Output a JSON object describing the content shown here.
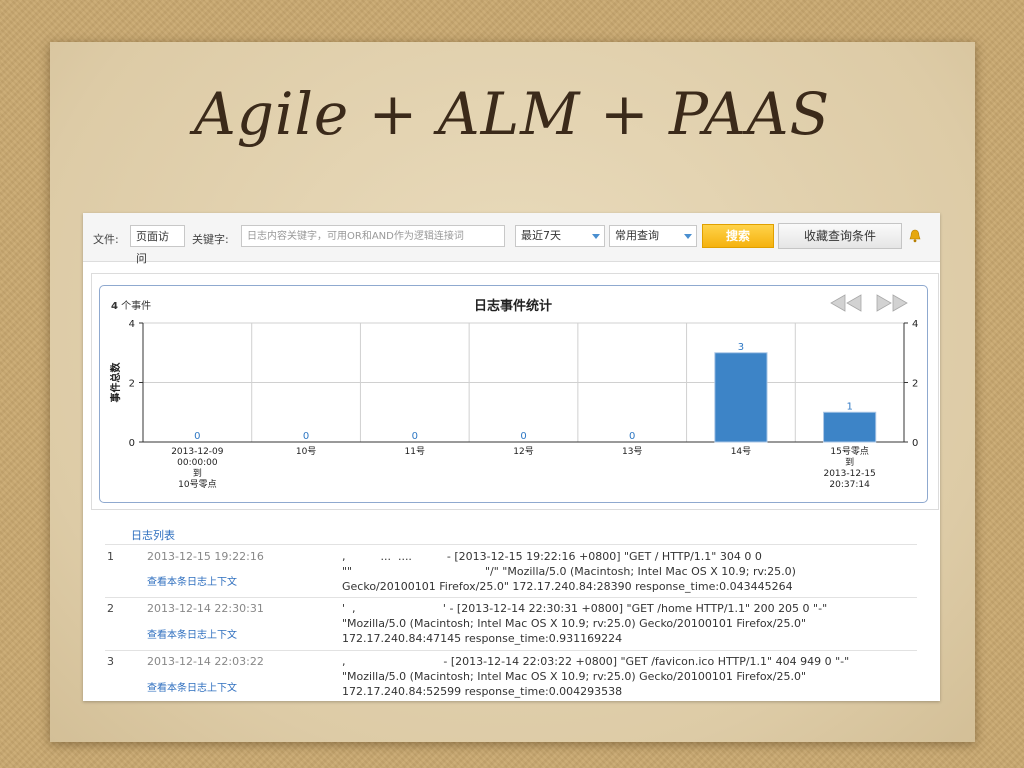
{
  "slide": {
    "title": "Agile + ALM + PAAS"
  },
  "toolbar": {
    "file_label": "文件:",
    "file_value": "页面访问",
    "keyword_label": "关键字:",
    "keyword_placeholder": "日志内容关键字，可用OR和AND作为逻辑连接词",
    "range_value": "最近7天",
    "query_value": "常用查询",
    "search_label": "搜索",
    "save_label": "收藏查询条件"
  },
  "chart": {
    "count_num": "4",
    "count_label": "个事件",
    "title": "日志事件统计",
    "ylabel": "事件总数"
  },
  "chart_data": {
    "type": "bar",
    "title": "日志事件统计",
    "ylabel": "事件总数",
    "xlabel": "",
    "ylim": [
      0,
      4
    ],
    "y_ticks": [
      "0",
      "2",
      "4"
    ],
    "categories": [
      "2013-12-09\n00:00:00\n到\n10号零点",
      "10号",
      "11号",
      "12号",
      "13号",
      "14号",
      "15号零点\n到\n2013-12-15\n20:37:14"
    ],
    "values": [
      0,
      0,
      0,
      0,
      0,
      3,
      1
    ],
    "data_labels": [
      "0",
      "0",
      "0",
      "0",
      "0",
      "3",
      "1"
    ],
    "bar_color": "#3d84c7",
    "grid": true
  },
  "log": {
    "header": "日志列表",
    "rows": [
      {
        "num": "1",
        "time": "2013-12-15 19:22:16",
        "link": "查看本条日志上下文",
        "message": ",          ...  ....          - [2013-12-15 19:22:16 +0800] \"GET / HTTP/1.1\" 304 0 0\n\"\"                                      \"/\" \"Mozilla/5.0 (Macintosh; Intel Mac OS X 10.9; rv:25.0)\nGecko/20100101 Firefox/25.0\" 172.17.240.84:28390 response_time:0.043445264"
      },
      {
        "num": "2",
        "time": "2013-12-14 22:30:31",
        "link": "查看本条日志上下文",
        "message": "'  ,                         ' - [2013-12-14 22:30:31 +0800] \"GET /home HTTP/1.1\" 200 205 0 \"-\"\n\"Mozilla/5.0 (Macintosh; Intel Mac OS X 10.9; rv:25.0) Gecko/20100101 Firefox/25.0\"\n172.17.240.84:47145 response_time:0.931169224"
      },
      {
        "num": "3",
        "time": "2013-12-14 22:03:22",
        "link": "查看本条日志上下文",
        "message": ",                            - [2013-12-14 22:03:22 +0800] \"GET /favicon.ico HTTP/1.1\" 404 949 0 \"-\"\n\"Mozilla/5.0 (Macintosh; Intel Mac OS X 10.9; rv:25.0) Gecko/20100101 Firefox/25.0\"\n172.17.240.84:52599 response_time:0.004293538"
      }
    ]
  },
  "colors": {
    "accent_blue": "#3d84c7",
    "search_yellow": "#f5b20f",
    "link_blue": "#2f6fbf"
  },
  "icons": {
    "nav_prev": "double-left-arrow-icon",
    "nav_next": "double-right-arrow-icon",
    "bell": "bell-icon",
    "dropdown": "chevron-down-icon"
  }
}
